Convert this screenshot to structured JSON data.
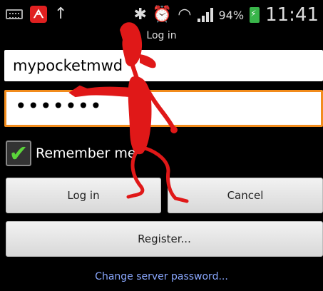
{
  "status_bar": {
    "icons_left": [
      "keyboard-icon",
      "app-icon",
      "upload-icon"
    ],
    "app_icon_glyph": "ᗅ",
    "upload_glyph": "↑",
    "icons_right": [
      "bluetooth-icon",
      "alarm-icon",
      "wifi-icon",
      "signal-icon",
      "battery-icon"
    ],
    "bluetooth_glyph": "✱",
    "alarm_glyph": "⏰",
    "wifi_glyph": "◠",
    "battery_percent": "94%",
    "time": "11:41"
  },
  "dialog": {
    "title": "Log in",
    "username_value": "mypocketmwd",
    "password_value": "•••••••",
    "remember_checked_glyph": "✔",
    "remember_label": "Remember me",
    "login_button": "Log in",
    "cancel_button": "Cancel",
    "register_button": "Register...",
    "change_password_link": "Change server password..."
  },
  "colors": {
    "background": "#000000",
    "focus_border": "#f28c1c",
    "checkmark": "#5bd43a",
    "link": "#8aa8ff",
    "stick_figure": "#e01818"
  }
}
